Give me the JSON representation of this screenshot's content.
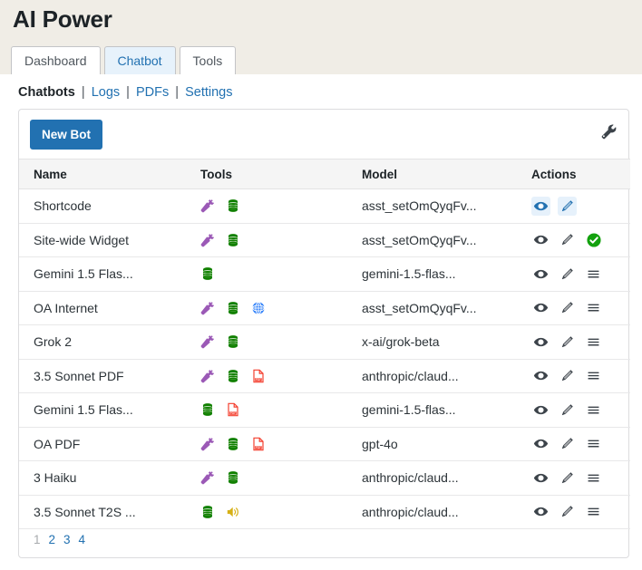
{
  "header": {
    "title": "AI Power"
  },
  "nav_tabs": [
    {
      "label": "Dashboard",
      "active": false
    },
    {
      "label": "Chatbot",
      "active": true
    },
    {
      "label": "Tools",
      "active": false
    }
  ],
  "subnav": {
    "current": "Chatbots",
    "separator": "|",
    "links": [
      "Logs",
      "PDFs",
      "Settings"
    ]
  },
  "toolbar": {
    "new_bot_label": "New Bot",
    "wrench_icon": "wrench-icon"
  },
  "table": {
    "columns": [
      "Name",
      "Tools",
      "Model",
      "Actions"
    ],
    "rows": [
      {
        "name": "Shortcode",
        "tools": [
          "plug-icon",
          "database-icon"
        ],
        "model": "asst_setOmQyqFv...",
        "actions": [
          "eye-icon",
          "pencil-icon"
        ],
        "actions_highlighted": true
      },
      {
        "name": "Site-wide Widget",
        "tools": [
          "plug-icon",
          "database-icon"
        ],
        "model": "asst_setOmQyqFv...",
        "actions": [
          "eye-icon",
          "pencil-icon",
          "check-circle-icon"
        ],
        "actions_highlighted": false
      },
      {
        "name": "Gemini 1.5 Flas...",
        "tools": [
          "database-icon"
        ],
        "model": "gemini-1.5-flas...",
        "actions": [
          "eye-icon",
          "pencil-icon",
          "menu-icon"
        ],
        "actions_highlighted": false
      },
      {
        "name": "OA Internet",
        "tools": [
          "plug-icon",
          "database-icon",
          "globe-icon"
        ],
        "model": "asst_setOmQyqFv...",
        "actions": [
          "eye-icon",
          "pencil-icon",
          "menu-icon"
        ],
        "actions_highlighted": false
      },
      {
        "name": "Grok 2",
        "tools": [
          "plug-icon",
          "database-icon"
        ],
        "model": "x-ai/grok-beta",
        "actions": [
          "eye-icon",
          "pencil-icon",
          "menu-icon"
        ],
        "actions_highlighted": false
      },
      {
        "name": "3.5 Sonnet PDF",
        "tools": [
          "plug-icon",
          "database-icon",
          "pdf-icon"
        ],
        "model": "anthropic/claud...",
        "actions": [
          "eye-icon",
          "pencil-icon",
          "menu-icon"
        ],
        "actions_highlighted": false
      },
      {
        "name": "Gemini 1.5 Flas...",
        "tools": [
          "database-icon",
          "pdf-icon"
        ],
        "model": "gemini-1.5-flas...",
        "actions": [
          "eye-icon",
          "pencil-icon",
          "menu-icon"
        ],
        "actions_highlighted": false
      },
      {
        "name": "OA PDF",
        "tools": [
          "plug-icon",
          "database-icon",
          "pdf-icon"
        ],
        "model": "gpt-4o",
        "actions": [
          "eye-icon",
          "pencil-icon",
          "menu-icon"
        ],
        "actions_highlighted": false
      },
      {
        "name": "3 Haiku",
        "tools": [
          "plug-icon",
          "database-icon"
        ],
        "model": "anthropic/claud...",
        "actions": [
          "eye-icon",
          "pencil-icon",
          "menu-icon"
        ],
        "actions_highlighted": false
      },
      {
        "name": "3.5 Sonnet T2S ...",
        "tools": [
          "database-icon",
          "speaker-icon"
        ],
        "model": "anthropic/claud...",
        "actions": [
          "eye-icon",
          "pencil-icon",
          "menu-icon"
        ],
        "actions_highlighted": false
      }
    ]
  },
  "pagination": {
    "pages": [
      "1",
      "2",
      "3",
      "4"
    ],
    "current": "1"
  },
  "colors": {
    "accent_blue": "#2271b1",
    "link_blue": "#2271b1",
    "page_background": "#f0ede6",
    "active_tab_background": "#e7f2fb",
    "table_header_background": "#f5f5f5",
    "plug_purple": "#9b59b6",
    "database_green": "#118000",
    "globe_blue": "#2d7ff9",
    "pdf_red": "#f43f2f",
    "speaker_yellow": "#d6b016",
    "check_green": "#13a10e",
    "icon_grey": "#3c434a"
  }
}
